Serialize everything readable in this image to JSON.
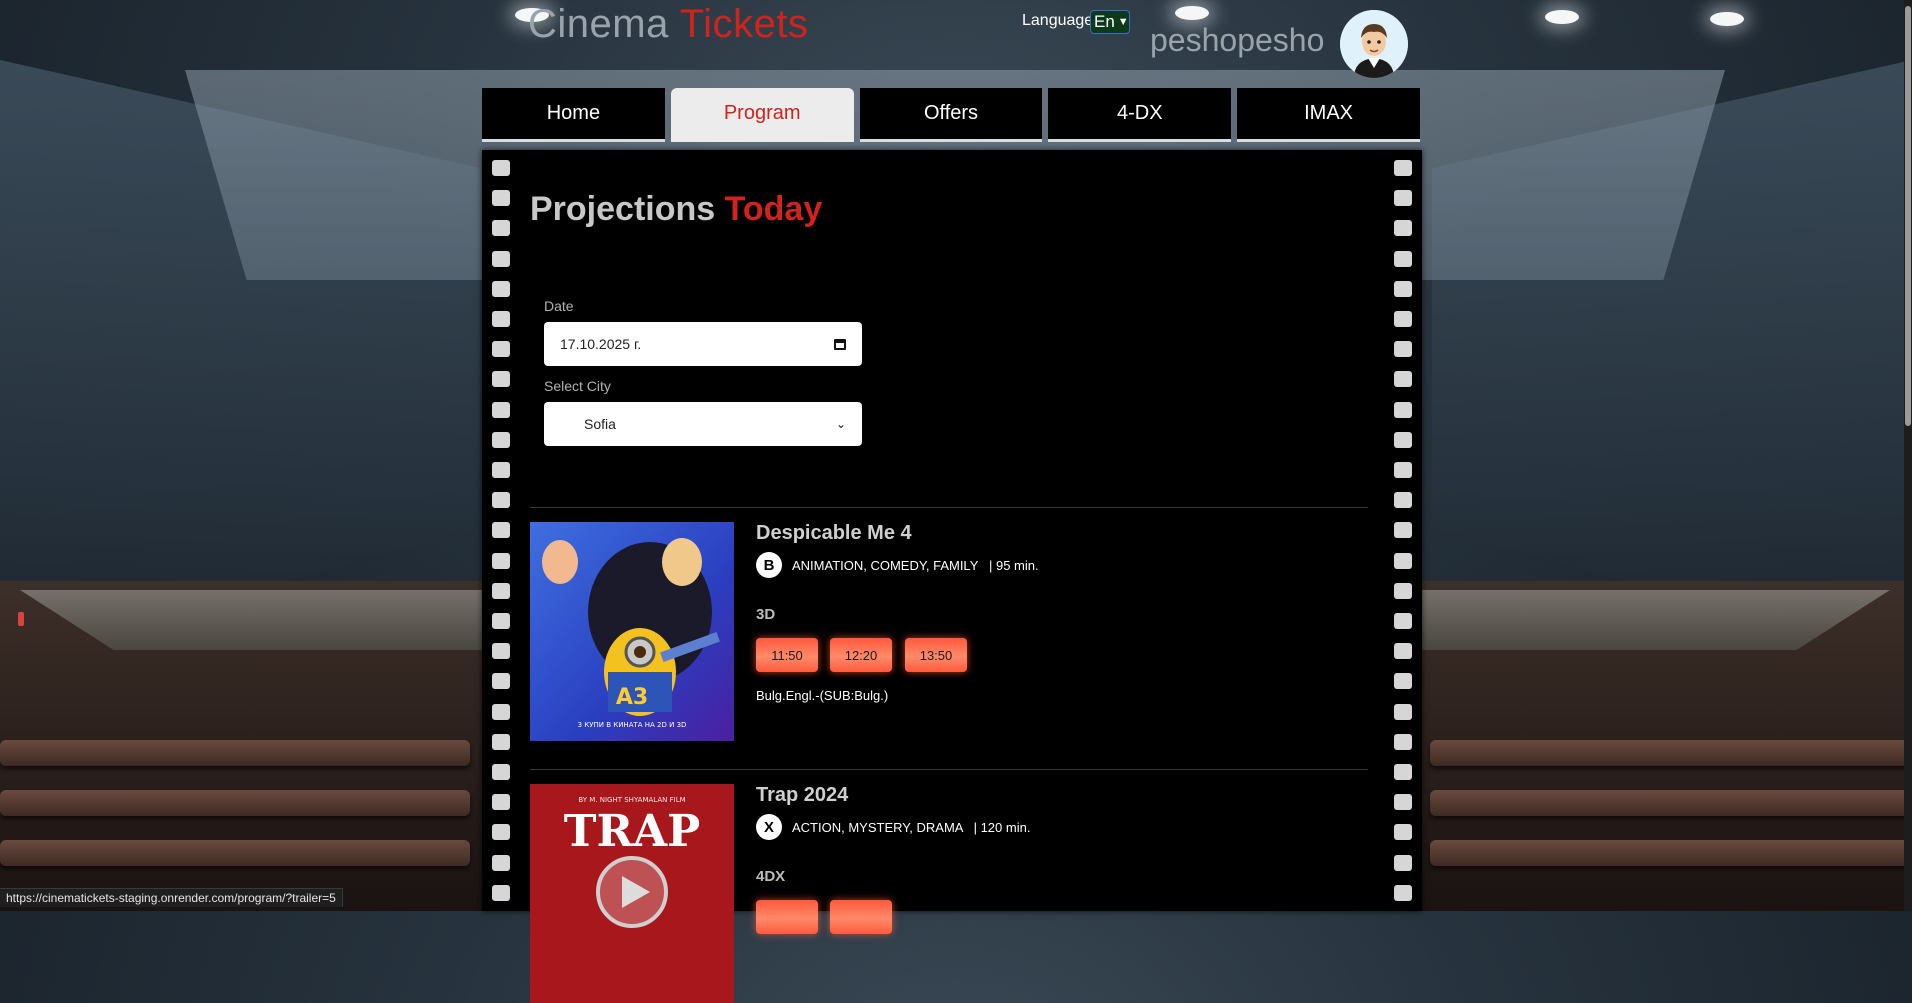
{
  "header": {
    "title_part1": "Cinema",
    "title_part2": "Tickets",
    "language_label": "Language",
    "language_value": "En",
    "username": "peshopesho"
  },
  "nav": {
    "tabs": [
      {
        "label": "Home"
      },
      {
        "label": "Program"
      },
      {
        "label": "Offers"
      },
      {
        "label": "4-DX"
      },
      {
        "label": "IMAX"
      }
    ],
    "active": "Program"
  },
  "page": {
    "heading_part1": "Projections",
    "heading_part2": "Today",
    "date_label": "Date",
    "date_value": "17.10.2025 г.",
    "city_label": "Select City",
    "city_value": "Sofia"
  },
  "movies": [
    {
      "title": "Despicable Me 4",
      "rating": "B",
      "genres": "ANIMATION, COMEDY, FAMILY",
      "duration": "| 95 min.",
      "format": "3D",
      "times": [
        "11:50",
        "12:20",
        "13:50"
      ],
      "language": "Bulg.Engl.-(SUB:Bulg.)",
      "poster_text": "А3",
      "poster_caption": "3 КУПИ В КИНАТА НА 2D И 3D"
    },
    {
      "title": "Trap 2024",
      "rating": "X",
      "genres": "ACTION, MYSTERY, DRAMA",
      "duration": "| 120 min.",
      "format": "4DX",
      "times": [
        "",
        ""
      ],
      "poster_text": "TRAP",
      "poster_caption": "BY M. NIGHT SHYAMALAN FILM"
    }
  ],
  "status_bar": {
    "url": "https://cinematickets-staging.onrender.com/program/?trailer=5"
  },
  "colors": {
    "accent": "#d0231c",
    "showtime": "#ff5a3c",
    "language_select_bg": "#0c3a1a"
  }
}
